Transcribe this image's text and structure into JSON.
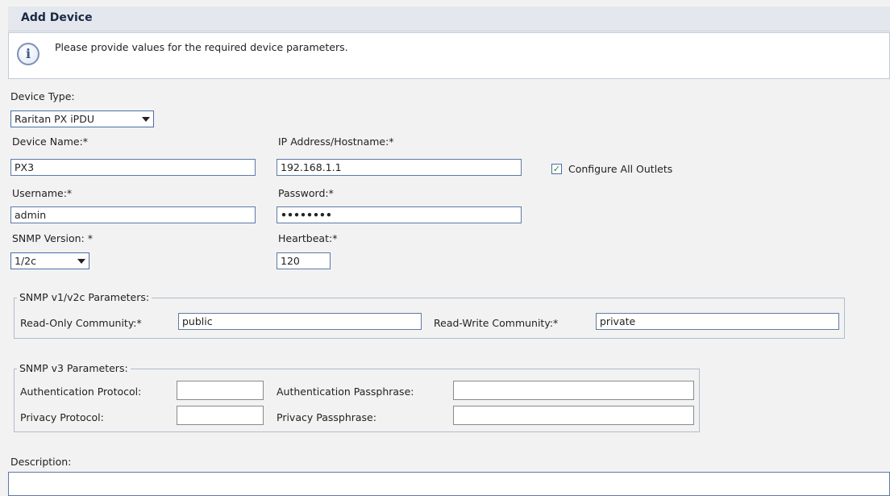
{
  "dialog": {
    "title": "Add Device",
    "info_text": "Please provide values for the required device parameters.",
    "info_icon": "info-icon"
  },
  "form": {
    "device_type_label": "Device Type:",
    "device_type_value": "Raritan PX iPDU",
    "device_name_label": "Device Name:*",
    "device_name_value": "PX3",
    "ip_label": "IP Address/Hostname:*",
    "ip_value": "192.168.1.1",
    "configure_outlets_label": "Configure All Outlets",
    "configure_outlets_checked": true,
    "username_label": "Username:*",
    "username_value": "admin",
    "password_label": "Password:*",
    "password_value": "••••••••",
    "snmp_version_label": "SNMP Version: *",
    "snmp_version_value": "1/2c",
    "heartbeat_label": "Heartbeat:*",
    "heartbeat_value": "120"
  },
  "snmp_v1v2c": {
    "legend": "SNMP v1/v2c Parameters:",
    "read_only_label": "Read-Only Community:*",
    "read_only_value": "public",
    "read_write_label": "Read-Write Community:*",
    "read_write_value": "private"
  },
  "snmp_v3": {
    "legend": "SNMP v3 Parameters:",
    "auth_protocol_label": "Authentication Protocol:",
    "auth_protocol_value": "",
    "auth_passphrase_label": "Authentication Passphrase:",
    "auth_passphrase_value": "",
    "privacy_protocol_label": "Privacy Protocol:",
    "privacy_protocol_value": "",
    "privacy_passphrase_label": "Privacy Passphrase:",
    "privacy_passphrase_value": ""
  },
  "description": {
    "label": "Description:",
    "value": ""
  },
  "colors": {
    "field_border": "#5d7aa6",
    "title_bg": "#e4e8ee",
    "checkmark": "#2e8b2e"
  }
}
